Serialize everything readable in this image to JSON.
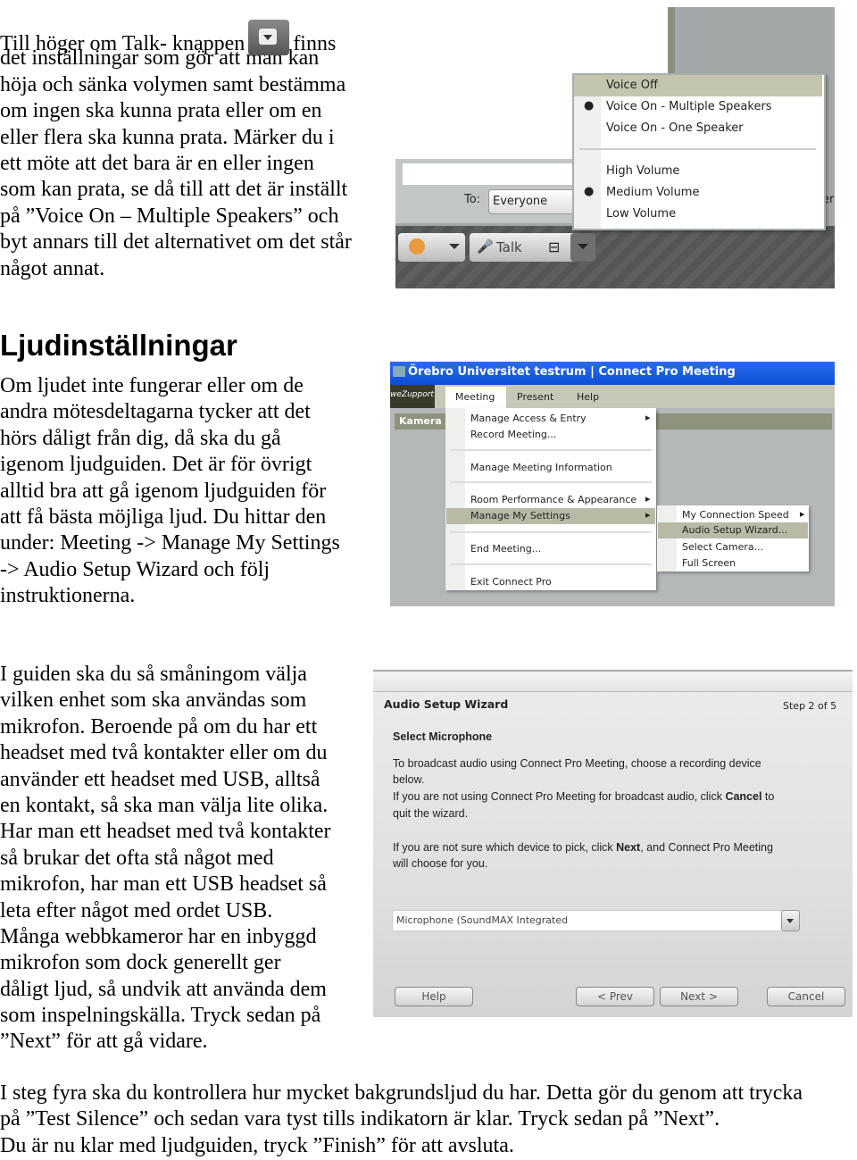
{
  "section1": {
    "line1_before": "Till höger om Talk- knappen",
    "line1_after": "finns",
    "lines": [
      "det inställningar som gör att man kan",
      "höja och sänka volymen samt bestämma",
      "om ingen ska kunna prata eller om en",
      "eller flera ska kunna prata. Märker du i",
      "ett möte att det bara är en eller ingen",
      "som kan prata, se då till att det är inställt",
      "på ”Voice On – Multiple Speakers” och",
      "byt annars till det alternativet om det står",
      "något annat."
    ]
  },
  "shot1": {
    "menu": [
      {
        "label": "Voice Off",
        "checked": false,
        "highlighted": true
      },
      {
        "label": "Voice On - Multiple Speakers",
        "checked": true
      },
      {
        "label": "Voice On - One Speaker",
        "checked": false
      },
      {
        "label": "High Volume",
        "checked": false
      },
      {
        "label": "Medium Volume",
        "checked": true
      },
      {
        "label": "Low Volume",
        "checked": false
      }
    ],
    "to_label": "To:",
    "to_value": "Everyone",
    "talk_label": "Talk",
    "cut_text": "er"
  },
  "heading": "Ljudinställningar",
  "section2": {
    "lines": [
      "Om ljudet inte fungerar eller om de",
      "andra mötesdeltagarna tycker att det",
      "hörs dåligt från dig, då ska du gå",
      "igenom ljudguiden. Det är för övrigt",
      "alltid bra att gå igenom ljudguiden för",
      "att få bästa möjliga ljud. Du hittar den",
      "under: Meeting -> Manage My Settings",
      "-> Audio Setup Wizard och följ",
      "instruktionerna."
    ]
  },
  "shot2": {
    "title": "Örebro Universitet testrum | Connect Pro Meeting",
    "logo": "weZupport",
    "menubar": [
      "Meeting",
      "Present",
      "Help"
    ],
    "pod_title": "Kamera",
    "menu": [
      "Manage Access & Entry",
      "Record Meeting...",
      "Manage Meeting Information",
      "Room Performance & Appearance",
      "Manage My Settings",
      "End Meeting...",
      "Exit Connect Pro"
    ],
    "submenu": [
      "My Connection Speed",
      "Audio Setup Wizard...",
      "Select Camera...",
      "Full Screen"
    ]
  },
  "section3": {
    "lines": [
      "I guiden ska du så småningom välja",
      "vilken enhet som ska användas som",
      "mikrofon. Beroende på om du har ett",
      "headset med två kontakter eller om du",
      "använder ett headset med USB, alltså",
      "en kontakt, så ska man välja lite olika.",
      "Har man ett headset med två kontakter",
      "så brukar det ofta stå något med",
      "mikrofon, har man ett USB headset så",
      "leta efter något med ordet USB.",
      "Många webbkameror har en inbyggd",
      "mikrofon som dock generellt ger",
      "dåligt ljud, så undvik att använda dem",
      "som inspelningskälla. Tryck sedan på",
      "”Next” för att gå vidare."
    ]
  },
  "shot3": {
    "title": "Audio Setup Wizard",
    "step": "Step 2 of 5",
    "subtitle": "Select Microphone",
    "p1a": "To broadcast audio using Connect Pro Meeting, choose a recording device",
    "p1b": "below.",
    "p2a": "If you are not using Connect Pro Meeting for broadcast audio, click ",
    "p2bold": "Cancel",
    "p2c": " to",
    "p2d": "quit the wizard.",
    "p3a": "If you are not sure which device to pick, click ",
    "p3bold": "Next",
    "p3c": ", and Connect Pro Meeting",
    "p3d": "will choose for you.",
    "select_value": "Microphone (SoundMAX Integrated",
    "buttons": {
      "help": "Help",
      "prev": "< Prev",
      "next": "Next >",
      "cancel": "Cancel"
    }
  },
  "section4": {
    "lines": [
      "I steg fyra ska du kontrollera hur mycket bakgrundsljud du har. Detta gör du genom att trycka",
      "på ”Test Silence” och sedan vara tyst tills indikatorn är klar. Tryck sedan på ”Next”.",
      "Du är nu klar med ljudguiden, tryck ”Finish” för att avsluta."
    ]
  }
}
